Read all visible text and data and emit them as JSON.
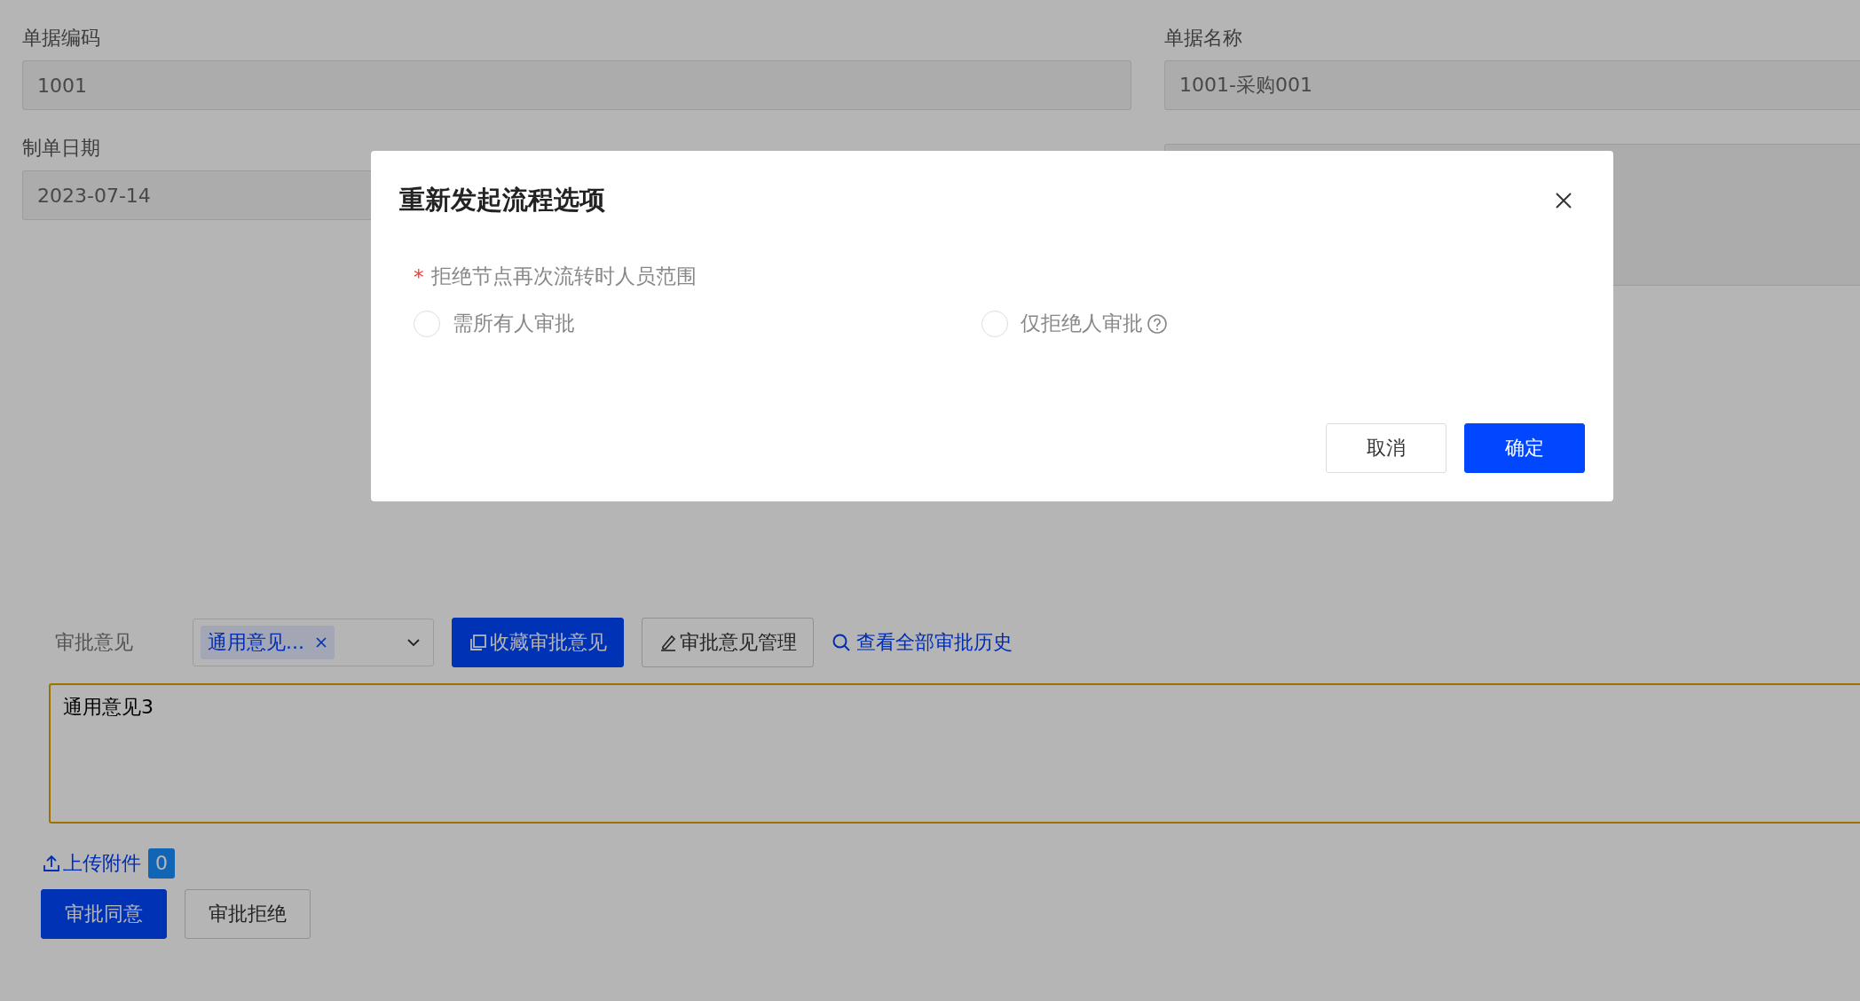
{
  "form": {
    "fields": [
      {
        "label": "单据编码",
        "value": "1001",
        "kind": "input"
      },
      {
        "label": "单据名称",
        "value": "1001-采购001",
        "kind": "input"
      },
      {
        "label": "制单日期",
        "value": "2023-07-14",
        "kind": "input"
      },
      {
        "kind": "textarea"
      }
    ]
  },
  "approval": {
    "label": "审批意见",
    "tag": "通用意见...",
    "favorite_button": "收藏审批意见",
    "manage_button": "审批意见管理",
    "history_link": "查看全部审批历史",
    "comment": "通用意见3",
    "upload_link": "上传附件",
    "upload_count": "0",
    "actions": [
      {
        "label": "审批同意",
        "primary": true
      },
      {
        "label": "审批拒绝",
        "primary": false
      }
    ]
  },
  "dialog": {
    "title": "重新发起流程选项",
    "field_label": "拒绝节点再次流转时人员范围",
    "required_mark": "*",
    "options": [
      {
        "label": "需所有人审批",
        "selected": false,
        "help": false
      },
      {
        "label": "仅拒绝人审批",
        "selected": false,
        "help": true
      }
    ],
    "cancel": "取消",
    "confirm": "确定"
  }
}
